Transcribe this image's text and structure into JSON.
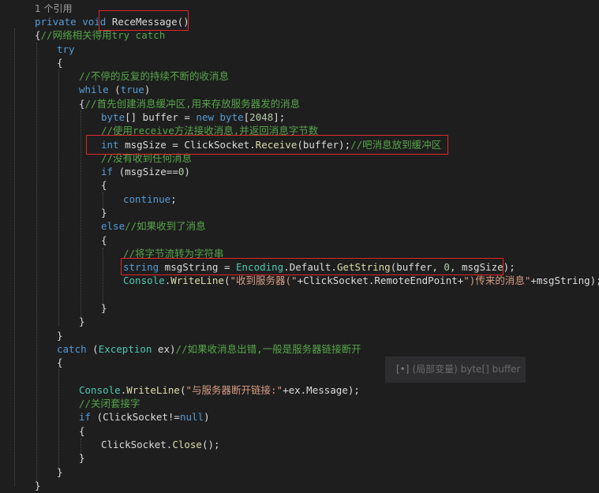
{
  "codelens": {
    "references": "1 个引用"
  },
  "lines": {
    "l1_kw": "private ",
    "l1_type": "void ",
    "l1_name": "ReceMessage",
    "l1_paren": "()",
    "l2_brace": "{",
    "l2_comment": "//网络相关得用try catch",
    "l3": "try",
    "l4": "{",
    "l5": "//不停的反复的持续不断的收消息",
    "l6_kw": "while",
    "l6_rest": " (",
    "l6_true": "true",
    "l6_close": ")",
    "l7_brace": "{",
    "l7_comment": "//首先创建消息缓冲区,用来存放服务器发的消息",
    "l8_type": "byte",
    "l8_mid": "[] buffer = ",
    "l8_new": "new",
    "l8_sp": " ",
    "l8_type2": "byte",
    "l8_num": "2048",
    "l8_end": "];",
    "l8_open": "[",
    "l9": "//使用receive方法接收消息,并返回消息字节数",
    "l10_kw": "int",
    "l10_a": " msgSize = ClickSocket.",
    "l10_fn": "Receive",
    "l10_b": "(buffer);",
    "l10_comment": "//吧消息放到缓冲区",
    "l11": "//没有收到任何消息",
    "l12_kw": "if",
    "l12_a": " (msgSize==",
    "l12_num": "0",
    "l12_b": ")",
    "l13": "{",
    "l14_kw": "continue",
    "l14_end": ";",
    "l15": "}",
    "l16_kw": "else",
    "l16_comment": "//如果收到了消息",
    "l17": "{",
    "l18": "//将字节流转为字符串",
    "l19_kw": "string",
    "l19_a": " msgString = ",
    "l19_type": "Encoding",
    "l19_b": ".Default.",
    "l19_fn": "GetString",
    "l19_c": "(buffer, ",
    "l19_num": "0",
    "l19_d": ", msgSize);",
    "l20_type": "Console",
    "l20_dot": ".",
    "l20_fn": "WriteLine",
    "l20_open": "(",
    "l20_str1": "\"收到服务器(\"",
    "l20_a": "+ClickSocket.RemoteEndPoint+",
    "l20_str2": "\")传来的消息\"",
    "l20_b": "+msgString);",
    "l21": "}",
    "l22": "}",
    "l23": "}",
    "l24_kw": "catch",
    "l24_a": " (",
    "l24_type": "Exception",
    "l24_b": " ex)",
    "l24_comment": "//如果收消息出错,一般是服务器链接断开",
    "l25": "{",
    "l26_type": "Console",
    "l26_dot": ".",
    "l26_fn": "WriteLine",
    "l26_open": "(",
    "l26_str": "\"与服务器断开链接:\"",
    "l26_b": "+ex.Message);",
    "l27": "//关闭套接字",
    "l28_kw": "if",
    "l28_a": " (ClickSocket!=",
    "l28_null": "null",
    "l28_b": ")",
    "l29": "{",
    "l30_a": "ClickSocket.",
    "l30_fn": "Close",
    "l30_b": "();",
    "l31": "}",
    "l32": "}",
    "l33": "}"
  },
  "tooltip": {
    "icon": "[•]",
    "text": "(局部变量) byte[] buffer"
  },
  "colors": {
    "background": "#1e1e1e",
    "keyword": "#569cd6",
    "type": "#4ec9b0",
    "comment": "#57a64a",
    "string": "#d69d85",
    "highlight": "#e0262c"
  }
}
